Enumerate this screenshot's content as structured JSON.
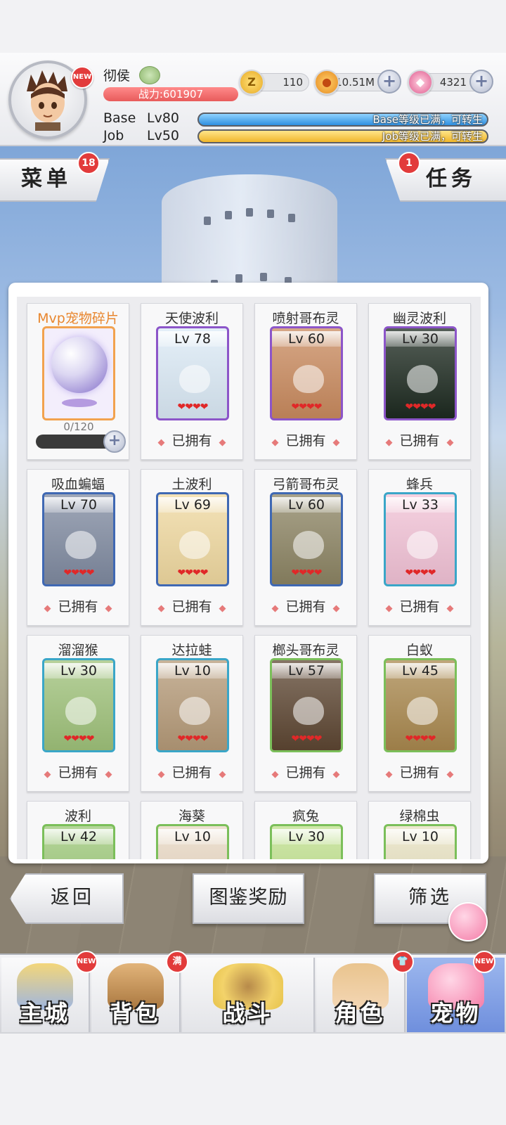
{
  "player": {
    "name": "彻侯",
    "power": "战力:601907",
    "avatar_badge": "NEW",
    "base_label": "Base",
    "base_level": "Lv80",
    "job_label": "Job",
    "job_level": "Lv50",
    "base_status": "Base等级已满，可转生",
    "job_status": "Job等级已满，可转生"
  },
  "currencies": {
    "zeny": "110",
    "gold": "10.51M",
    "gem": "4321"
  },
  "tabs": {
    "menu_label": "菜单",
    "menu_badge": "18",
    "task_label": "任务",
    "task_badge": "1"
  },
  "pets": {
    "mvp": {
      "title": "Mvp宠物碎片",
      "count": "0/120",
      "progress": 0
    },
    "owned_label": "已拥有",
    "hearts": "❤❤❤❤",
    "items": [
      {
        "name": "天使波利",
        "level": "Lv 78",
        "frame": "purple",
        "art": "#dbeaf6"
      },
      {
        "name": "喷射哥布灵",
        "level": "Lv 60",
        "frame": "purple",
        "art": "#c98a5e"
      },
      {
        "name": "幽灵波利",
        "level": "Lv 30",
        "frame": "purple",
        "art": "#1d2a20"
      },
      {
        "name": "吸血蝙蝠",
        "level": "Lv 70",
        "frame": "blue",
        "art": "#7f8aa0"
      },
      {
        "name": "土波利",
        "level": "Lv 69",
        "frame": "blue",
        "art": "#f0d9a0"
      },
      {
        "name": "弓箭哥布灵",
        "level": "Lv 60",
        "frame": "blue",
        "art": "#8c8463"
      },
      {
        "name": "蜂兵",
        "level": "Lv 33",
        "frame": "teal",
        "art": "#f2c2d6"
      },
      {
        "name": "溜溜猴",
        "level": "Lv 30",
        "frame": "teal",
        "art": "#9fc27a"
      },
      {
        "name": "达拉蛙",
        "level": "Lv 10",
        "frame": "teal",
        "art": "#b59a78"
      },
      {
        "name": "榔头哥布灵",
        "level": "Lv 57",
        "frame": "green",
        "art": "#5d4632"
      },
      {
        "name": "白蚁",
        "level": "Lv 45",
        "frame": "green",
        "art": "#a9884e"
      },
      {
        "name": "波利",
        "level": "Lv 42",
        "frame": "green",
        "art": "#9cc878"
      },
      {
        "name": "海葵",
        "level": "Lv 10",
        "frame": "green",
        "art": "#e8d7c2"
      },
      {
        "name": "疯兔",
        "level": "Lv 30",
        "frame": "green",
        "art": "#bfe08c"
      },
      {
        "name": "绿棉虫",
        "level": "Lv 10",
        "frame": "green",
        "art": "#e7e1c0"
      }
    ]
  },
  "buttons": {
    "back": "返回",
    "reward": "图鉴奖励",
    "filter": "筛选"
  },
  "nav": {
    "items": [
      {
        "label": "主城",
        "badge": "NEW"
      },
      {
        "label": "背包",
        "badge": "满"
      },
      {
        "label": "战斗",
        "badge": ""
      },
      {
        "label": "角色",
        "badge": "👕"
      },
      {
        "label": "宠物",
        "badge": "NEW"
      }
    ]
  },
  "colors": {
    "accent_red": "#e23b3b",
    "mvp_orange": "#e8862e",
    "active_nav": "#7f9fe3"
  }
}
